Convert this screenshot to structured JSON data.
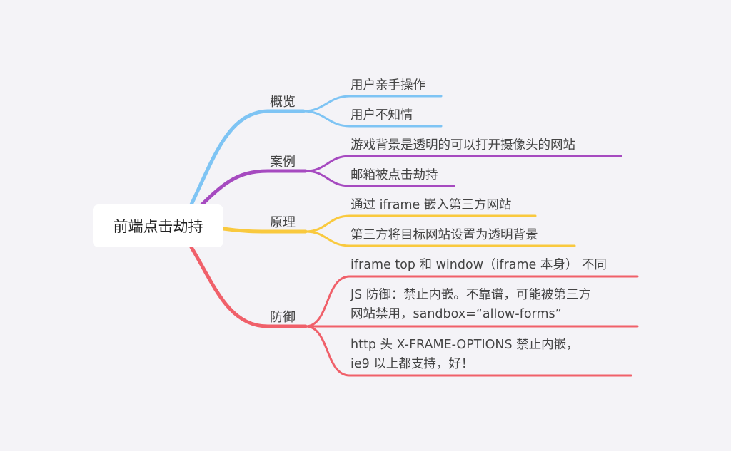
{
  "root": {
    "label": "前端点击劫持"
  },
  "branches": [
    {
      "label": "概览",
      "color": "#7ec4f4",
      "items": [
        "用户亲手操作",
        "用户不知情"
      ]
    },
    {
      "label": "案例",
      "color": "#a64ac0",
      "items": [
        "游戏背景是透明的可以打开摄像头的网站",
        "邮箱被点击劫持"
      ]
    },
    {
      "label": "原理",
      "color": "#f9c93e",
      "items": [
        "通过 iframe 嵌入第三方网站",
        "第三方将目标网站设置为透明背景"
      ]
    },
    {
      "label": "防御",
      "color": "#f0606a",
      "items": [
        "iframe top 和 window（iframe 本身） 不同",
        {
          "line1": "JS 防御：禁止内嵌。不靠谱，可能被第三方",
          "line2": "网站禁用，sandbox=“allow-forms”"
        },
        {
          "line1": "http 头 X-FRAME-OPTIONS 禁止内嵌，",
          "line2": "ie9 以上都支持，好！"
        }
      ]
    }
  ]
}
